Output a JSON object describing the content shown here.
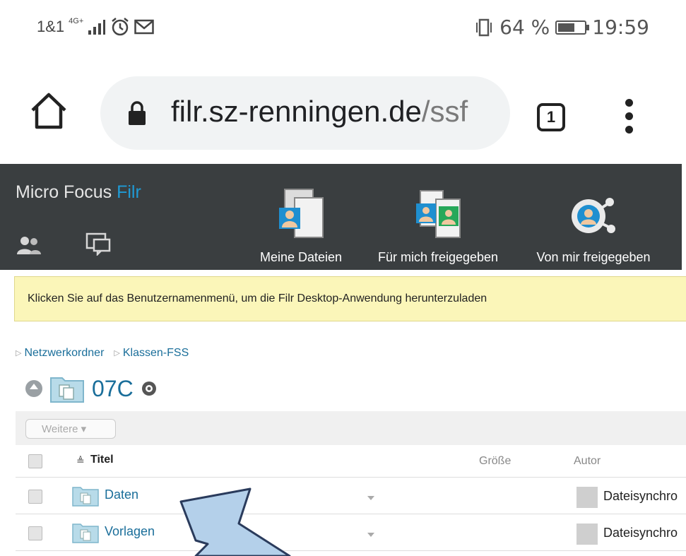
{
  "status_bar": {
    "carrier": "1&1",
    "network": "4G+",
    "battery_percent": "64 %",
    "battery_level": 0.64,
    "time": "19:59",
    "icons": [
      "signal-icon",
      "alarm-icon",
      "mail-icon",
      "vibrate-icon"
    ]
  },
  "browser": {
    "url_host": "filr.sz-renningen.de",
    "url_path": "/ssf",
    "tab_count": "1",
    "icons": [
      "home-icon",
      "lock-icon",
      "more-vert-icon"
    ]
  },
  "app_header": {
    "brand": "Micro Focus",
    "product": "Filr",
    "nav": [
      {
        "label": "Meine Dateien",
        "icon": "my-files-icon"
      },
      {
        "label": "Für mich freigegeben",
        "icon": "shared-with-me-icon"
      },
      {
        "label": "Von mir freigegeben",
        "icon": "shared-by-me-icon"
      }
    ],
    "colors": {
      "header_bg": "#3a3e40",
      "accent": "#1f9bd6"
    }
  },
  "notice": {
    "text": "Klicken Sie auf das Benutzernamenmenü, um die Filr Desktop-Anwendung herunterzuladen",
    "bg": "#fbf6b9"
  },
  "breadcrumb": [
    "Netzwerkordner",
    "Klassen-FSS"
  ],
  "folder": {
    "title": "07C"
  },
  "toolbar": {
    "more_label": "Weitere"
  },
  "table": {
    "columns": [
      "Titel",
      "Größe",
      "Autor"
    ],
    "rows": [
      {
        "title": "Daten",
        "size": "",
        "author": "Dateisynchro"
      },
      {
        "title": "Vorlagen",
        "size": "",
        "author": "Dateisynchro"
      }
    ]
  }
}
